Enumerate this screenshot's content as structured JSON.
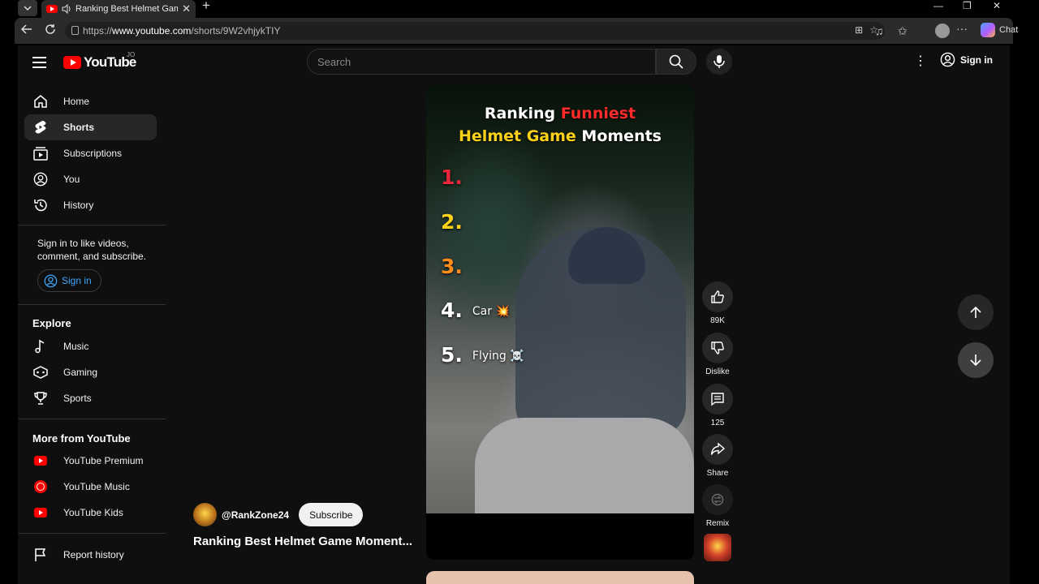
{
  "browser": {
    "tab_title": "Ranking Best Helmet Game M",
    "tab_close": "✕",
    "new_tab": "+",
    "url_prefix": "https://",
    "url_host": "www.youtube.com",
    "url_path": "/shorts/9W2vhjykTIY",
    "chat_label": "Chat",
    "window_controls": [
      "—",
      "❐",
      "✕"
    ]
  },
  "youtube": {
    "logo_text": "YouTube",
    "country_code": "JO",
    "search_placeholder": "Search",
    "sign_in_label": "Sign in"
  },
  "sidebar": {
    "items": [
      {
        "label": "Home"
      },
      {
        "label": "Shorts"
      },
      {
        "label": "Subscriptions"
      },
      {
        "label": "You"
      },
      {
        "label": "History"
      }
    ],
    "signin_prompt": "Sign in to like videos, comment, and subscribe.",
    "signin_button": "Sign in",
    "explore_heading": "Explore",
    "explore_items": [
      {
        "label": "Music"
      },
      {
        "label": "Gaming"
      },
      {
        "label": "Sports"
      }
    ],
    "more_heading": "More from YouTube",
    "more_items": [
      {
        "label": "YouTube Premium"
      },
      {
        "label": "YouTube Music"
      },
      {
        "label": "YouTube Kids"
      }
    ],
    "report_history": "Report history"
  },
  "video": {
    "overlay_title_1_white": "Ranking ",
    "overlay_title_1_red": "Funniest",
    "overlay_title_2_yellow": "Helmet Game ",
    "overlay_title_2_white": "Moments",
    "ranks": [
      {
        "num": "1.",
        "label": "",
        "color": "#e8283a"
      },
      {
        "num": "2.",
        "label": "",
        "color": "#ffd21a"
      },
      {
        "num": "3.",
        "label": "",
        "color": "#ff8c1a"
      },
      {
        "num": "4.",
        "label": "Car 💥",
        "color": "#ffffff"
      },
      {
        "num": "5.",
        "label": "Flying ☠️",
        "color": "#ffffff"
      }
    ],
    "channel_handle": "@RankZone24",
    "subscribe_label": "Subscribe",
    "title": "Ranking Best Helmet Game Moment..."
  },
  "actions": {
    "like_count": "89K",
    "dislike_label": "Dislike",
    "comment_count": "125",
    "share_label": "Share",
    "remix_label": "Remix"
  },
  "colors": {
    "page_bg": "#0f0f0f",
    "accent_red": "#ff0000",
    "link_blue": "#3ea6ff",
    "button_bg": "#272727"
  }
}
